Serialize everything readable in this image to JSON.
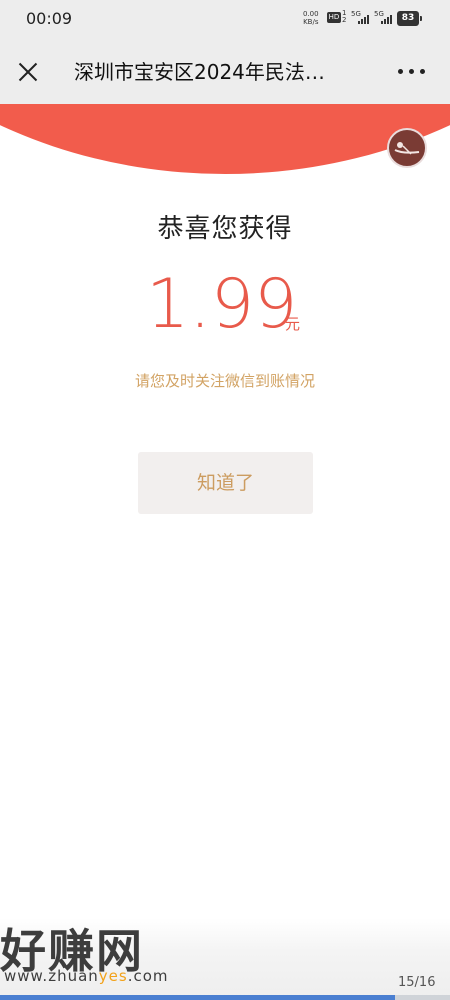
{
  "status_bar": {
    "time": "00:09",
    "net_speed_value": "0.00",
    "net_speed_unit": "KB/s",
    "hd_label": "HD",
    "sim_sub": "1\n2",
    "signal1_label": "5G",
    "signal2_label": "5G",
    "battery": "83"
  },
  "nav": {
    "title": "深圳市宝安区2024年民法…"
  },
  "reward": {
    "congrats": "恭喜您获得",
    "amount": "1.99",
    "unit": "元",
    "hint": "请您及时关注微信到账情况",
    "button_label": "知道了"
  },
  "watermark": {
    "logo_text": "好赚网",
    "url_prefix": "www.zhuan",
    "url_highlight": "yes",
    "url_suffix": ".com"
  },
  "page_indicator": "15/16",
  "colors": {
    "accent_red": "#f25c4c",
    "amount_red": "#e85a4b",
    "hint_gold": "#d2a364",
    "button_bg": "#f2efee"
  }
}
